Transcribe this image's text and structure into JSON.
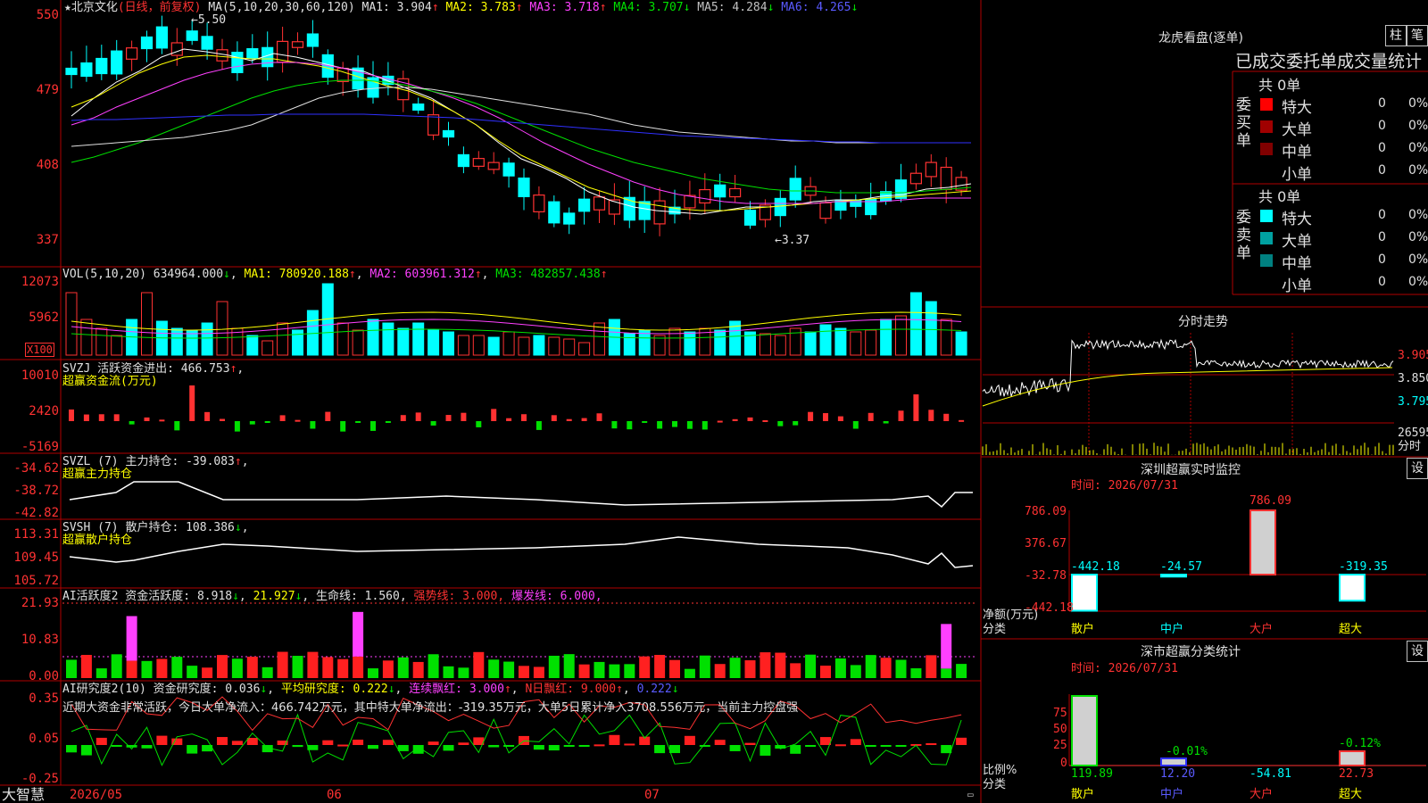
{
  "header": {
    "star": "★",
    "stock_name": "北京文化",
    "period": "(日线，前复权)",
    "ma_label": "MA(5,10,20,30,60,120)",
    "ma1": "MA1: 3.904",
    "ma2": "MA2: 3.783",
    "ma3": "MA3: 3.718",
    "ma4": "MA4: 3.707",
    "ma5": "MA5: 4.284",
    "ma6": "MA6: 4.265",
    "up_arrow": "↑",
    "down_arrow": "↓"
  },
  "price_axis": [
    "550",
    "479",
    "408",
    "337"
  ],
  "price_marks": {
    "high": "5.50",
    "low": "←3.37",
    "high_arrow": "←"
  },
  "vol_panel": {
    "title": "VOL(5,10,20)",
    "value": "634964.000",
    "ma1": "MA1: 780920.188",
    "ma2": "MA2: 603961.312",
    "ma3": "MA3: 482857.438",
    "axis": [
      "12073",
      "5962"
    ],
    "unit": "X100"
  },
  "svzj_panel": {
    "title": "SVZJ  活跃资金进出: 466.753",
    "sub": "超赢资金流(万元)",
    "axis": [
      "10010",
      "2420",
      "-5169"
    ]
  },
  "svzl_panel": {
    "title": "SVZL (7) 主力持仓: -39.083",
    "sub": "超赢主力持仓",
    "axis": [
      "-34.62",
      "-38.72",
      "-42.82"
    ]
  },
  "svsh_panel": {
    "title": "SVSH (7) 散户持仓: 108.386",
    "sub": "超赢散户持仓",
    "axis": [
      "113.31",
      "109.45",
      "105.72"
    ]
  },
  "ai1_panel": {
    "title": "AI活跃度2 资金活跃度: 8.918",
    "v2": "21.927",
    "v3": "生命线: 1.560",
    "v4": "强势线: 3.000",
    "v5": "爆发线: 6.000",
    "axis": [
      "21.93",
      "10.83",
      "0.00"
    ]
  },
  "ai2_panel": {
    "title": "AI研究度2(10) 资金研究度: 0.036",
    "v2": "平均研究度: 0.222",
    "v3": "连续飘红: 3.000",
    "v4": "N日飘红: 9.000",
    "v5": "0.222",
    "note": "近期大资金非常活跃，今日大单净流入：466.742万元，其中特大单净流出：-319.35万元，大单5日累计净入3708.556万元，当前主力控盘强",
    "axis": [
      "0.35",
      "0.05",
      "-0.25"
    ]
  },
  "time_axis": {
    "brand": "大智慧",
    "labels": [
      "2026/05",
      "06",
      "07"
    ]
  },
  "dragon": {
    "title": "龙虎看盘(逐单)",
    "btn_col": "柱",
    "btn_pen": "笔",
    "subtitle": "已成交委托单成交量统计",
    "buy_label": "委买单",
    "sell_label": "委卖单",
    "buy_total": "共 0单",
    "sell_total": "共 0单",
    "rows": [
      {
        "name": "特大",
        "count": "0",
        "pct": "0%"
      },
      {
        "name": "大单",
        "count": "0",
        "pct": "0%"
      },
      {
        "name": "中单",
        "count": "0",
        "pct": "0%"
      },
      {
        "name": "小单",
        "count": "0",
        "pct": "0%"
      }
    ],
    "colors": {
      "buy": [
        "#ff0000",
        "#a00000",
        "#800000"
      ],
      "sell": [
        "#00ffff",
        "#00a0a0",
        "#008080"
      ]
    }
  },
  "intraday": {
    "title": "分时走势",
    "axis": [
      "3.905",
      "3.850",
      "3.795"
    ],
    "vol": "26595",
    "unit": "分时"
  },
  "sz_monitor": {
    "title": "深圳超赢实时监控",
    "btn": "设",
    "time": "时间: 2026/07/31",
    "axis": [
      "786.09",
      "376.67",
      "-32.78",
      "-442.18"
    ],
    "values": [
      "-442.18",
      "-24.57",
      "786.09",
      "-319.35"
    ],
    "cats": [
      "散户",
      "中户",
      "大户",
      "超大"
    ],
    "ylabel": "净额(万元)",
    "xlabel": "分类"
  },
  "sz_stats": {
    "title": "深市超赢分类统计",
    "btn": "设",
    "time": "时间: 2026/07/31",
    "axis": [
      "75",
      "50",
      "25",
      "0"
    ],
    "pcts": [
      "-0.01%",
      "-0.12%"
    ],
    "values": [
      "119.89",
      "12.20",
      "-54.81",
      "22.73"
    ],
    "cats": [
      "散户",
      "中户",
      "大户",
      "超大"
    ],
    "ylabel": "比例%",
    "xlabel": "分类"
  }
}
